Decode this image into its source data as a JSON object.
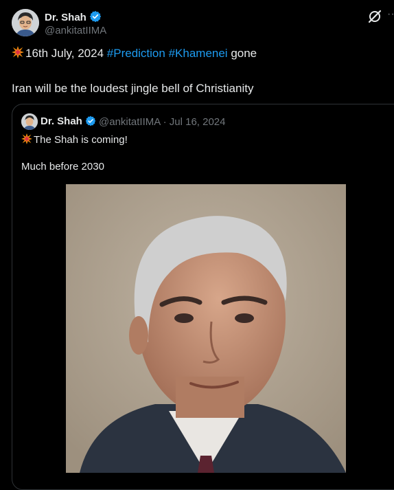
{
  "tweet": {
    "display_name": "Dr. Shah",
    "handle": "@ankitatIIMA",
    "line1_prefix": "16th July, 2024 ",
    "hashtags": [
      "#Prediction",
      "#Khamenei"
    ],
    "line1_suffix": " gone",
    "line2": "Iran will be the loudest jingle bell of Christianity",
    "more_label": "···"
  },
  "quoted": {
    "display_name": "Dr. Shah",
    "meta": "@ankitatIIMA · Jul 16, 2024",
    "text1": "The Shah is coming!",
    "text2": "Much before 2030"
  },
  "icons": {
    "verified": "verified-badge-icon",
    "grok": "grok-icon",
    "emoji": "collision-emoji-icon"
  },
  "colors": {
    "background": "#000000",
    "text": "#e7e9ea",
    "secondary": "#71767b",
    "accent": "#1d9bf0",
    "border": "#2f3336"
  }
}
